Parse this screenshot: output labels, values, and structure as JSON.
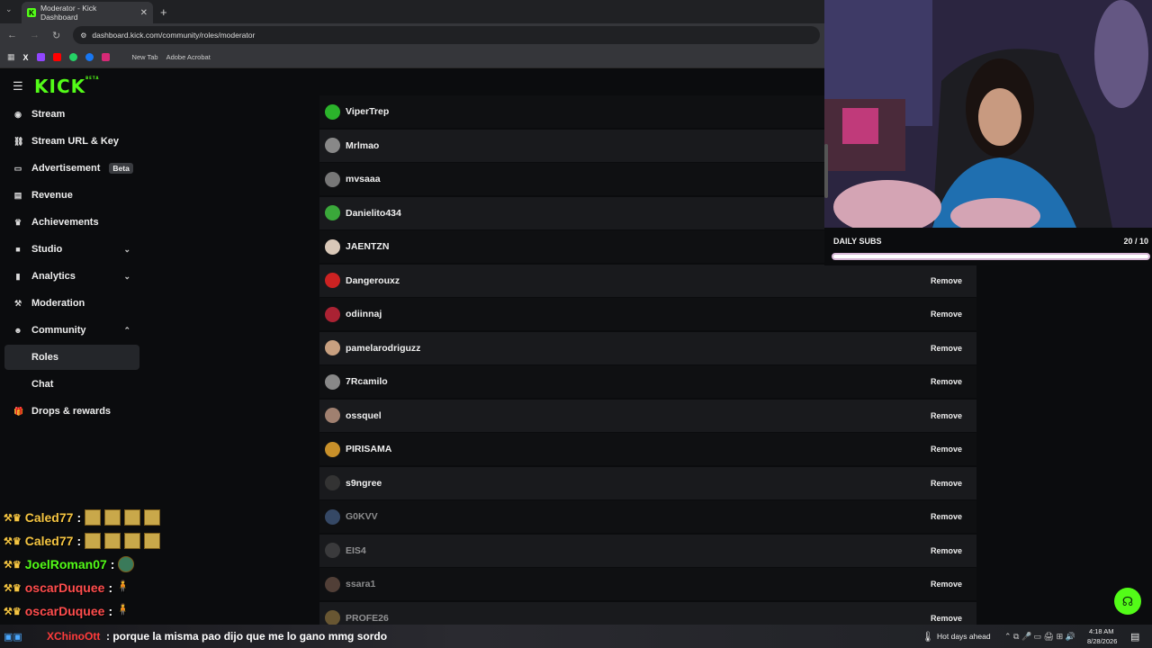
{
  "browser": {
    "tab_title": "Moderator - Kick Dashboard",
    "url": "dashboard.kick.com/community/roles/moderator",
    "bookmarks": [
      "New Tab",
      "Adobe Acrobat"
    ]
  },
  "sidebar": {
    "logo": "KICK",
    "logo_sup": "BETA",
    "items": [
      {
        "label": "Stream",
        "icon": "radio-icon"
      },
      {
        "label": "Stream URL & Key",
        "icon": "link-icon"
      },
      {
        "label": "Advertisement",
        "icon": "monitor-icon",
        "badge": "Beta"
      },
      {
        "label": "Revenue",
        "icon": "revenue-icon"
      },
      {
        "label": "Achievements",
        "icon": "trophy-icon"
      },
      {
        "label": "Studio",
        "icon": "studio-icon",
        "expandable": true
      },
      {
        "label": "Analytics",
        "icon": "chart-icon",
        "expandable": true
      },
      {
        "label": "Moderation",
        "icon": "hammer-icon"
      },
      {
        "label": "Community",
        "icon": "people-icon",
        "expanded": true
      },
      {
        "label": "Roles",
        "active": true
      },
      {
        "label": "Chat"
      },
      {
        "label": "Drops & rewards",
        "icon": "gift-icon"
      }
    ]
  },
  "moderators": {
    "remove_label": "Remove",
    "rows": [
      {
        "name": "ViperTrep",
        "color": "#2bb32b"
      },
      {
        "name": "Mrlmao",
        "color": "#888888"
      },
      {
        "name": "mvsaaa",
        "color": "#777777"
      },
      {
        "name": "Danielito434",
        "color": "#3aa83a"
      },
      {
        "name": "JAENTZN",
        "color": "#d9c8b8"
      },
      {
        "name": "Dangerouxz",
        "color": "#cc2222"
      },
      {
        "name": "odiinnaj",
        "color": "#aa2233"
      },
      {
        "name": "pamelarodriguzz",
        "color": "#c8a080"
      },
      {
        "name": "7Rcamilo",
        "color": "#888888"
      },
      {
        "name": "ossquel",
        "color": "#a08070"
      },
      {
        "name": "PIRISAMA",
        "color": "#c8902a"
      },
      {
        "name": "s9ngree",
        "color": "#333333"
      },
      {
        "name": "G0KVV",
        "color": "#5577aa"
      },
      {
        "name": "EIS4",
        "color": "#555555"
      },
      {
        "name": "ssara1",
        "color": "#886655"
      },
      {
        "name": "PROFE26",
        "color": "#aa8844"
      }
    ]
  },
  "overlay": {
    "daily_subs_label": "DAILY SUBS",
    "daily_subs_count": "20 / 10",
    "daily_subs_progress": 1.0
  },
  "chat": [
    {
      "user": "Caled77",
      "sep": ":",
      "color": "#f5c542"
    },
    {
      "user": "Caled77",
      "sep": ":",
      "color": "#f5c542"
    },
    {
      "user": "JoelRoman07",
      "sep": ":",
      "color": "#53fc18"
    },
    {
      "user": "oscarDuquee",
      "sep": ":",
      "color": "#ff4d4d"
    },
    {
      "user": "oscarDuquee",
      "sep": ":",
      "color": "#ff4d4d"
    }
  ],
  "ticker": {
    "user": "XChinoOtt",
    "message": ": porque la misma pao dijo que me lo gano mmg sordo"
  },
  "taskbar": {
    "weather": "Hot days ahead",
    "time": "4:18 AM",
    "date": "8/28/2026"
  }
}
